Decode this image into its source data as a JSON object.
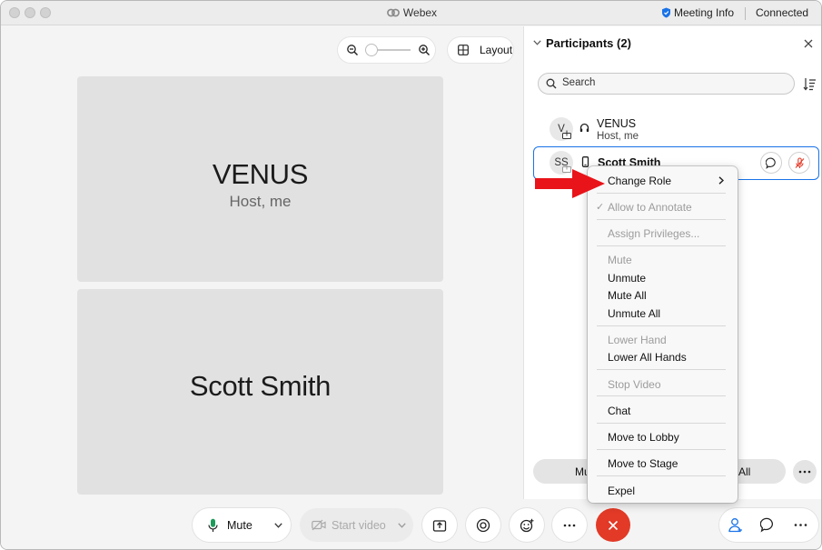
{
  "titlebar": {
    "app_name": "Webex",
    "meeting_info": "Meeting Info",
    "status": "Connected"
  },
  "stage": {
    "layout_label": "Layout",
    "zoom_level": 0,
    "tiles": [
      {
        "name": "VENUS",
        "subtitle": "Host, me"
      },
      {
        "name": "Scott Smith",
        "subtitle": ""
      }
    ]
  },
  "participants": {
    "header": "Participants (2)",
    "search_placeholder": "Search",
    "rows": [
      {
        "initials": "V",
        "name": "VENUS",
        "role": "Host, me",
        "device": "headset-icon"
      },
      {
        "initials": "SS",
        "name": "Scott Smith",
        "role": "",
        "device": "phone-icon"
      }
    ],
    "footer_left": "Mu",
    "footer_right": "All"
  },
  "context_menu": {
    "items": [
      {
        "label": "Change Role",
        "enabled": true,
        "submenu": true
      },
      {
        "label": "Allow to Annotate",
        "enabled": false,
        "checked": true
      },
      {
        "label": "Assign Privileges...",
        "enabled": false
      },
      {
        "label": "Mute",
        "enabled": false
      },
      {
        "label": "Unmute",
        "enabled": true
      },
      {
        "label": "Mute All",
        "enabled": true
      },
      {
        "label": "Unmute All",
        "enabled": true
      },
      {
        "label": "Lower Hand",
        "enabled": false
      },
      {
        "label": "Lower All Hands",
        "enabled": true
      },
      {
        "label": "Stop Video",
        "enabled": false
      },
      {
        "label": "Chat",
        "enabled": true
      },
      {
        "label": "Move to Lobby",
        "enabled": true
      },
      {
        "label": "Move to Stage",
        "enabled": true
      },
      {
        "label": "Expel",
        "enabled": true
      }
    ]
  },
  "controls": {
    "mute_label": "Mute",
    "video_label": "Start video"
  },
  "colors": {
    "accent": "#1a73e8",
    "end_call": "#e23a27",
    "mic_green": "#1d9b5a",
    "annotation": "#e8141a"
  }
}
